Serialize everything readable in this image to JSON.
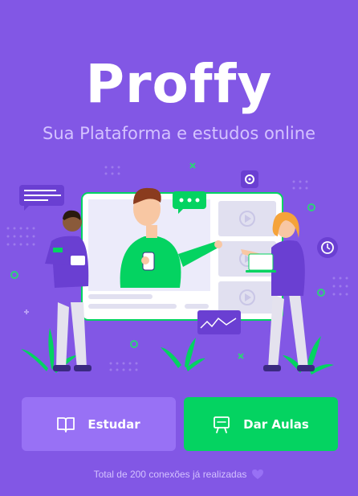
{
  "brand": {
    "name": "Proffy"
  },
  "hero": {
    "subtitle": "Sua Plataforma e estudos online"
  },
  "actions": {
    "study_label": "Estudar",
    "teach_label": "Dar Aulas"
  },
  "footer": {
    "connections_text": "Total de 200 conexões já realizadas"
  },
  "colors": {
    "background": "#8257e5",
    "primary_light": "#9871f5",
    "secondary": "#04d361",
    "text_in_primary": "#d4c2ff"
  },
  "icons": {
    "study": "book-open-icon",
    "teach": "presentation-board-icon",
    "heart": "heart-icon"
  }
}
